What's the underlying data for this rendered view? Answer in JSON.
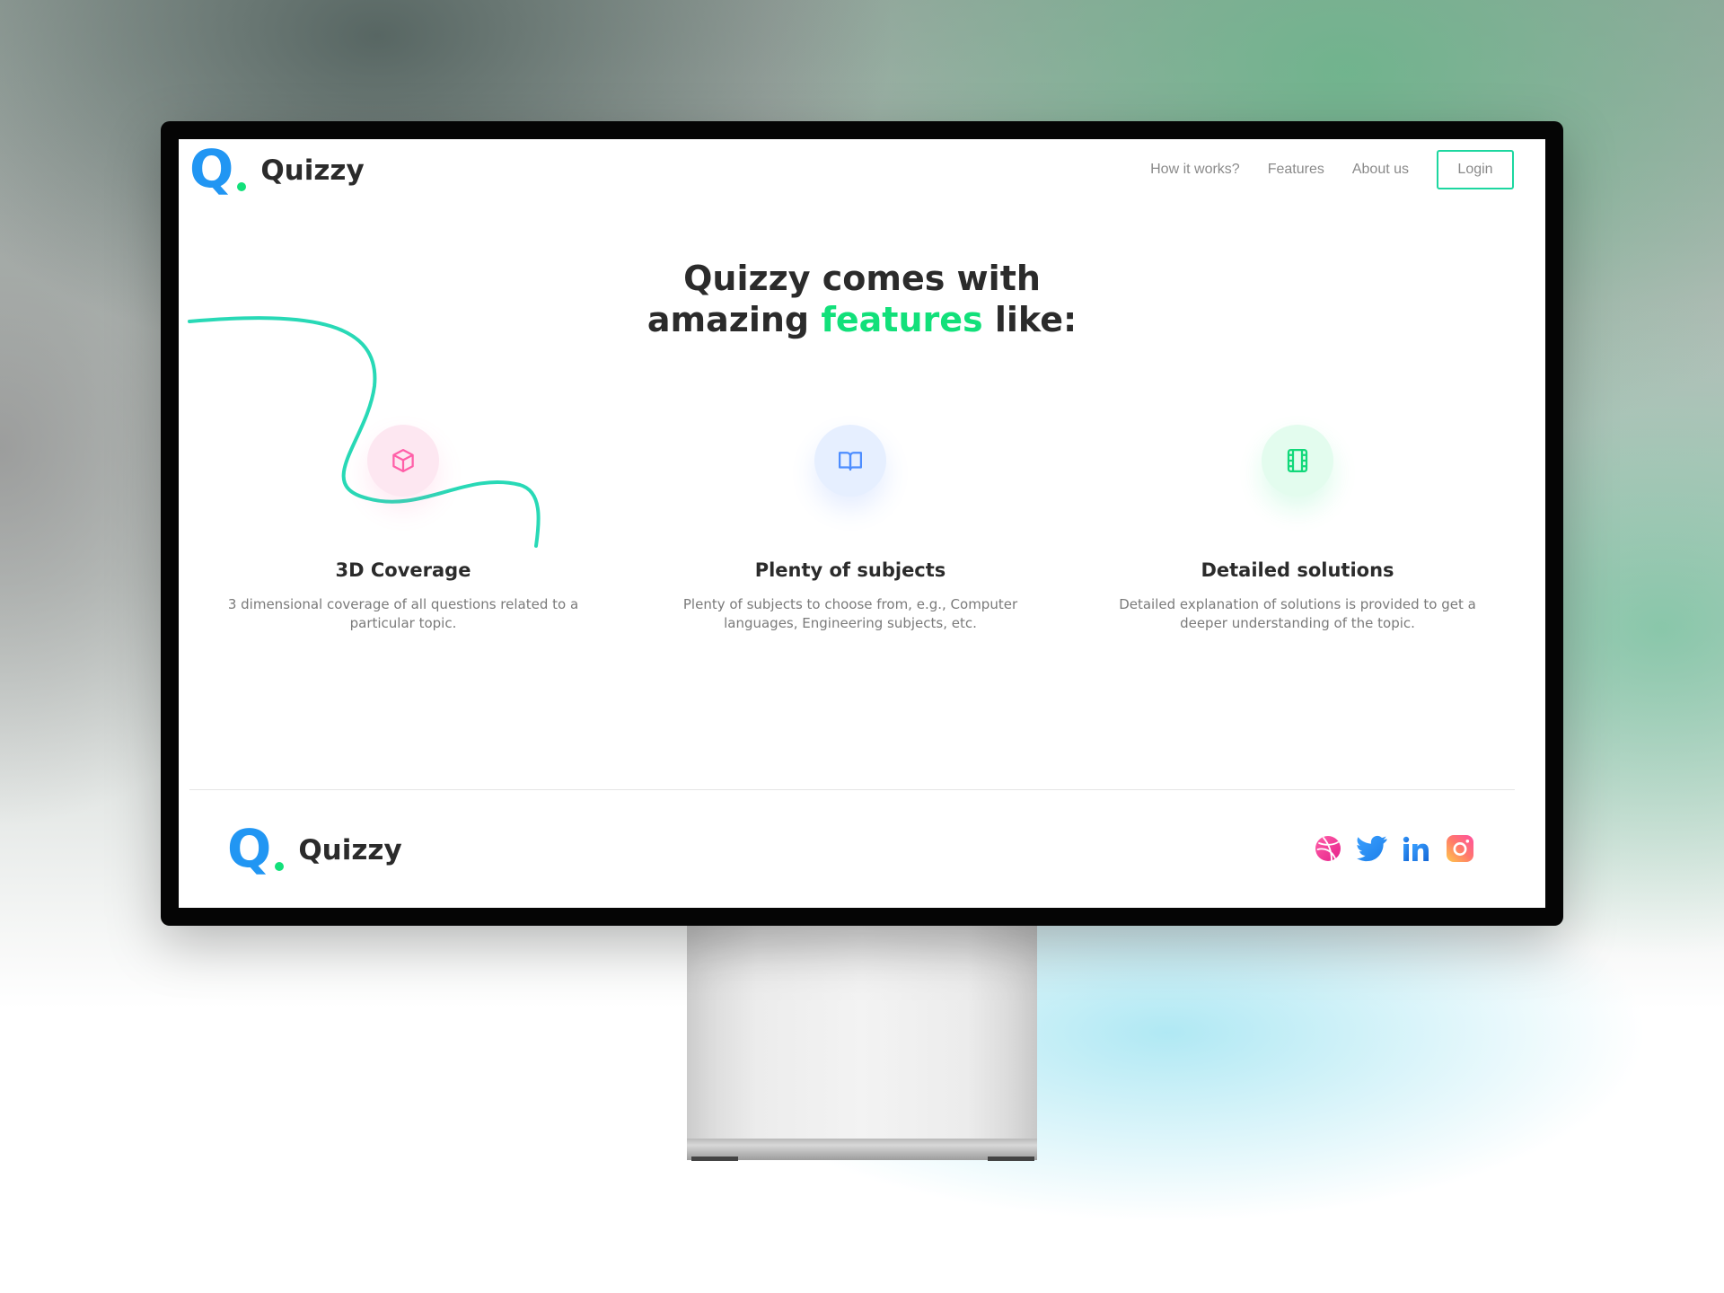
{
  "header": {
    "brand_letter": "Q",
    "brand_name": "Quizzy",
    "nav": [
      {
        "label": "How it works?"
      },
      {
        "label": "Features"
      },
      {
        "label": "About us"
      }
    ],
    "login_label": "Login"
  },
  "hero": {
    "line1": "Quizzy comes with",
    "line2_before": "amazing ",
    "line2_accent": "features",
    "line2_after": " like:"
  },
  "features": [
    {
      "icon": "cube-icon",
      "title": "3D Coverage",
      "description": "3 dimensional coverage of all questions related to a particular topic."
    },
    {
      "icon": "open-book-icon",
      "title": "Plenty of subjects",
      "description": "Plenty of subjects to choose from, e.g., Computer languages, Engineering subjects, etc."
    },
    {
      "icon": "film-icon",
      "title": "Detailed solutions",
      "description": "Detailed explanation of solutions is provided to get a deeper understanding of the topic."
    }
  ],
  "footer": {
    "brand_letter": "Q",
    "brand_name": "Quizzy",
    "socials": [
      "dribbble-icon",
      "twitter-icon",
      "linkedin-icon",
      "instagram-icon"
    ]
  },
  "colors": {
    "brand_blue": "#2196f3",
    "accent_green": "#12e07a",
    "login_border": "#1dd7a0",
    "curve": "#28d9b6"
  }
}
